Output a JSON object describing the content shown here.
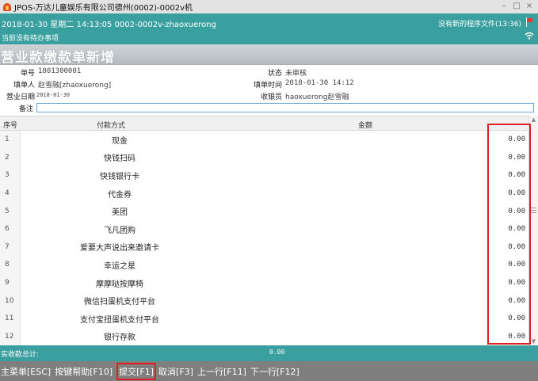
{
  "window": {
    "title": "JPOS-万达儿童娱乐有限公司德州(0002)-0002v机",
    "controls": {
      "minimize": "–",
      "maximize": "□",
      "close": "×"
    }
  },
  "info": {
    "session": "2018-01-30 星期二 14:13:05 0002-0002v-zhaoxuerong",
    "pending": "当前没有待办事项",
    "update_notice": "没有新的程序文件(13:36)"
  },
  "page": {
    "title": "营业款缴款单新增"
  },
  "form": {
    "doc_no_label": "单号",
    "doc_no": "1801300001",
    "status_label": "状态",
    "status": "未审核",
    "filler_label": "填单人",
    "filler": "赵雪融[zhaoxuerong]",
    "fill_time_label": "填单时间",
    "fill_time": "2018-01-30 14:12",
    "biz_date_label": "营业日期",
    "biz_date": "2018-01-30",
    "cashier_label": "收银员",
    "cashier": "haoxuerong赵雪融",
    "memo_label": "备注",
    "memo": ""
  },
  "table": {
    "headers": {
      "seq": "序号",
      "method": "付款方式",
      "amount": "金额"
    },
    "rows": [
      {
        "seq": "1",
        "method": "现金",
        "amount": "0.00"
      },
      {
        "seq": "2",
        "method": "快钱扫码",
        "amount": "0.00"
      },
      {
        "seq": "3",
        "method": "快钱银行卡",
        "amount": "0.00"
      },
      {
        "seq": "4",
        "method": "代金券",
        "amount": "0.00"
      },
      {
        "seq": "5",
        "method": "美团",
        "amount": "0.00"
      },
      {
        "seq": "6",
        "method": "飞凡团购",
        "amount": "0.00"
      },
      {
        "seq": "7",
        "method": "爱要大声说出来邀请卡",
        "amount": "0.00"
      },
      {
        "seq": "8",
        "method": "幸运之星",
        "amount": "0.00"
      },
      {
        "seq": "9",
        "method": "摩摩哒按摩椅",
        "amount": "0.00"
      },
      {
        "seq": "10",
        "method": "微信扫蛋机支付平台",
        "amount": "0.00"
      },
      {
        "seq": "11",
        "method": "支付宝扭蛋机支付平台",
        "amount": "0.00"
      },
      {
        "seq": "12",
        "method": "银行存款",
        "amount": "0.00"
      }
    ]
  },
  "summary": {
    "label": "实收款总计:",
    "value": "0.00"
  },
  "shortcuts": [
    {
      "label": "主菜单[ESC]"
    },
    {
      "label": "按键帮助[F10]"
    },
    {
      "label": "提交[F1]"
    },
    {
      "label": "取消[F3]"
    },
    {
      "label": "上一行[F11]"
    },
    {
      "label": "下一行[F12]"
    }
  ],
  "colors": {
    "teal": "#3a9f9f",
    "highlight": "#e02020",
    "bottom_bar": "#7f7f7f"
  }
}
